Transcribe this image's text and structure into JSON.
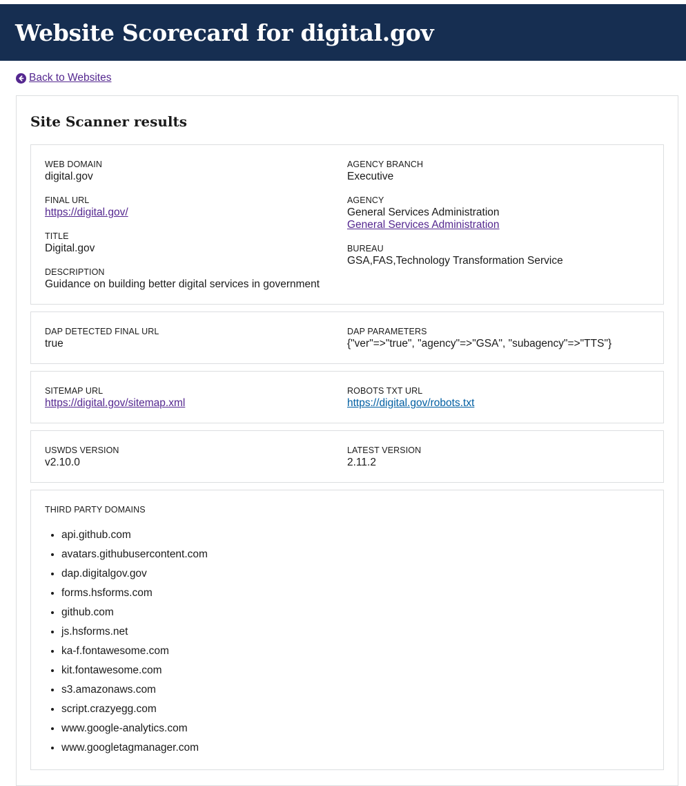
{
  "header": {
    "title": "Website Scorecard for digital.gov"
  },
  "nav": {
    "back_label": "Back to Websites",
    "back_icon": "arrow-circle-left-icon"
  },
  "section": {
    "title": "Site Scanner results"
  },
  "colors": {
    "header_bg": "#162e51",
    "visited_link": "#54278f",
    "link": "#005ea2",
    "border": "#dcdee0"
  },
  "overview": {
    "web_domain_label": "WEB DOMAIN",
    "web_domain": "digital.gov",
    "final_url_label": "FINAL URL",
    "final_url": "https://digital.gov/",
    "title_label": "TITLE",
    "title": "Digital.gov",
    "description_label": "DESCRIPTION",
    "description": "Guidance on building better digital services in government",
    "agency_branch_label": "AGENCY BRANCH",
    "agency_branch": "Executive",
    "agency_label": "AGENCY",
    "agency": "General Services Administration",
    "agency_link": "General Services Administration",
    "bureau_label": "BUREAU",
    "bureau": "GSA,FAS,Technology Transformation Service"
  },
  "dap": {
    "detected_label": "DAP DETECTED FINAL URL",
    "detected": "true",
    "parameters_label": "DAP PARAMETERS",
    "parameters": "{\"ver\"=>\"true\", \"agency\"=>\"GSA\", \"subagency\"=>\"TTS\"}"
  },
  "files": {
    "sitemap_label": "SITEMAP URL",
    "sitemap": "https://digital.gov/sitemap.xml",
    "robots_label": "ROBOTS TXT URL",
    "robots": "https://digital.gov/robots.txt"
  },
  "uswds": {
    "version_label": "USWDS VERSION",
    "version": "v2.10.0",
    "latest_label": "LATEST VERSION",
    "latest": "2.11.2"
  },
  "third_party": {
    "label": "THIRD PARTY DOMAINS",
    "domains": [
      "api.github.com",
      "avatars.githubusercontent.com",
      "dap.digitalgov.gov",
      "forms.hsforms.com",
      "github.com",
      "js.hsforms.net",
      "ka-f.fontawesome.com",
      "kit.fontawesome.com",
      "s3.amazonaws.com",
      "script.crazyegg.com",
      "www.google-analytics.com",
      "www.googletagmanager.com"
    ]
  }
}
